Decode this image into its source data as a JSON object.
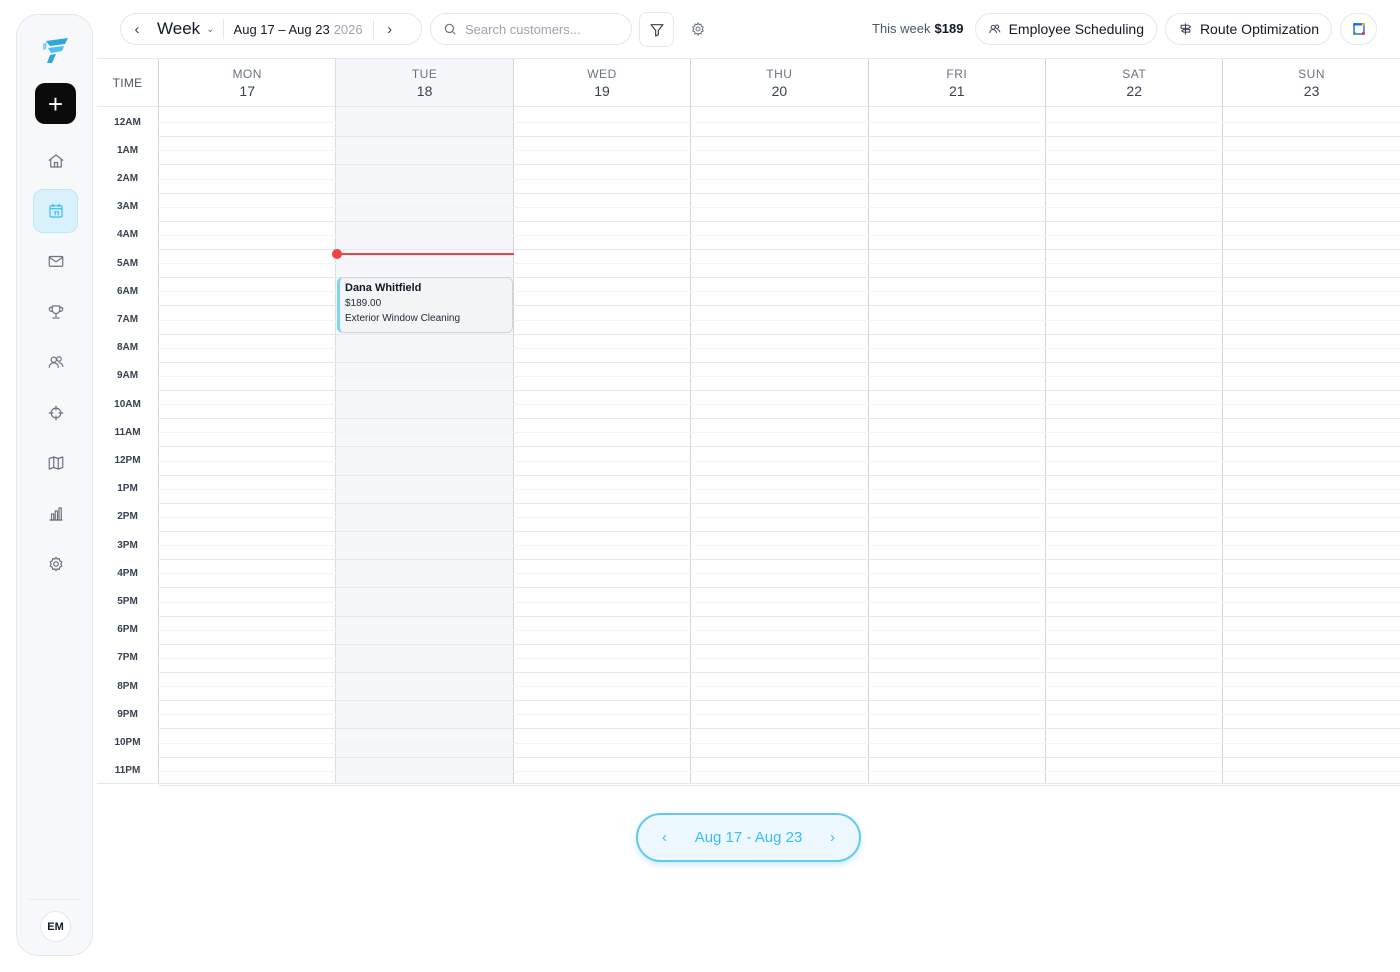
{
  "toolbar": {
    "view_label": "Week",
    "range_label": "Aug 17 – Aug 23",
    "range_year": "2026",
    "search_placeholder": "Search customers...",
    "week_total_label": "This week",
    "week_total_value": "$189",
    "employee_scheduling_label": "Employee Scheduling",
    "route_optimization_label": "Route Optimization"
  },
  "sidebar": {
    "add_label": "+",
    "avatar_initials": "EM",
    "items": [
      {
        "icon": "home-icon"
      },
      {
        "icon": "calendar-icon",
        "active": true
      },
      {
        "icon": "mail-icon"
      },
      {
        "icon": "trophy-icon"
      },
      {
        "icon": "users-icon"
      },
      {
        "icon": "crosshair-icon"
      },
      {
        "icon": "map-icon"
      },
      {
        "icon": "bar-chart-icon"
      },
      {
        "icon": "gear-icon"
      }
    ]
  },
  "calendar": {
    "time_header": "TIME",
    "days": [
      {
        "name": "MON",
        "num": "17"
      },
      {
        "name": "TUE",
        "num": "18"
      },
      {
        "name": "WED",
        "num": "19"
      },
      {
        "name": "THU",
        "num": "20"
      },
      {
        "name": "FRI",
        "num": "21"
      },
      {
        "name": "SAT",
        "num": "22"
      },
      {
        "name": "SUN",
        "num": "23"
      }
    ],
    "hours": [
      "12AM",
      "1AM",
      "2AM",
      "3AM",
      "4AM",
      "5AM",
      "6AM",
      "7AM",
      "8AM",
      "9AM",
      "10AM",
      "11AM",
      "12PM",
      "1PM",
      "2PM",
      "3PM",
      "4PM",
      "5PM",
      "6PM",
      "7PM",
      "8PM",
      "9PM",
      "10PM",
      "11PM"
    ],
    "event": {
      "customer": "Dana Whitfield",
      "price": "$189.00",
      "service": "Exterior Window Cleaning"
    }
  },
  "footer_nav": {
    "range_label": "Aug 17 - Aug 23"
  },
  "colors": {
    "accent": "#38bdf8",
    "now_line": "#ef4444"
  }
}
